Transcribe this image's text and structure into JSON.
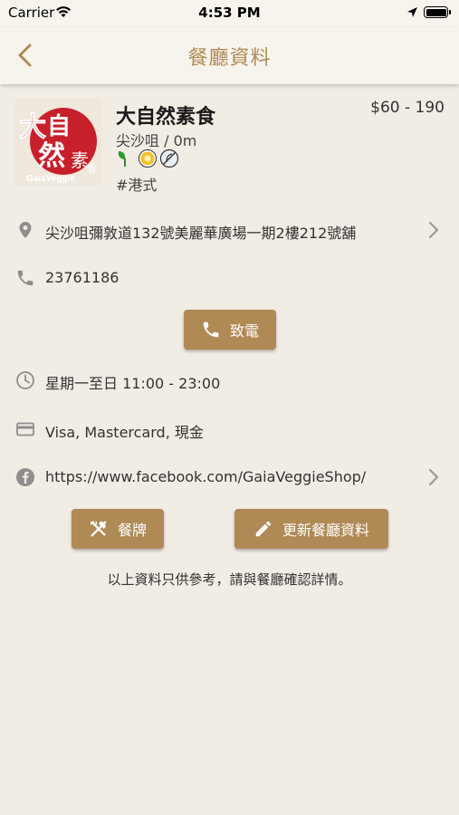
{
  "status_bar": {
    "carrier": "Carrier",
    "time": "4:53 PM"
  },
  "nav": {
    "title": "餐廳資料"
  },
  "restaurant": {
    "logo_text": "GaiaVeggie",
    "name": "大自然素食",
    "district_distance": "尖沙咀 / 0m",
    "price": "$60 - 190",
    "cuisine": "#港式"
  },
  "details": {
    "address": "尖沙咀彌敦道132號美麗華廣場一期2樓212號舖",
    "phone": "23761186",
    "call_label": "致電",
    "hours": "星期一至日 11:00 - 23:00",
    "payment": "Visa, Mastercard, 現金",
    "facebook": "https://www.facebook.com/GaiaVeggieShop/"
  },
  "actions": {
    "menu_label": "餐牌",
    "update_label": "更新餐廳資料"
  },
  "disclaimer": "以上資料只供參考，請與餐廳確認詳情。",
  "colors": {
    "accent": "#b08a55",
    "background": "#f1ece4",
    "icon_gray": "#8e8e8e"
  }
}
